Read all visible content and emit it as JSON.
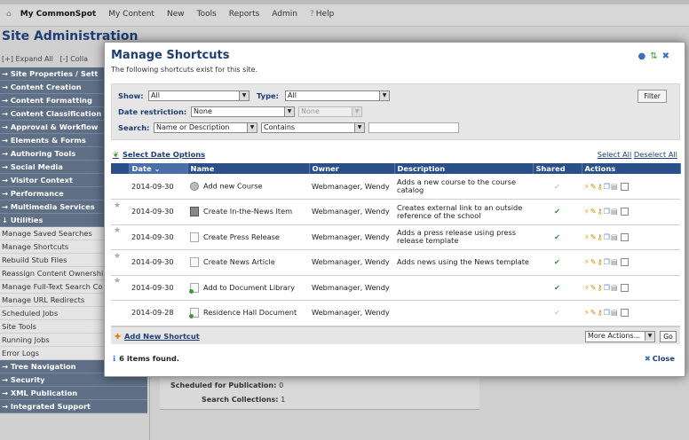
{
  "topbar": {
    "brand": "My CommonSpot",
    "menu": [
      "My Content",
      "New",
      "Tools",
      "Reports",
      "Admin"
    ],
    "help": "Help"
  },
  "background": {
    "title": "Site Administration",
    "expand_all": "[+] Expand All",
    "collapse_all": "[-] Colla",
    "sidebar": [
      {
        "label": "→ Site Properties / Sett",
        "style": "dark"
      },
      {
        "label": "→ Content Creation",
        "style": "dark"
      },
      {
        "label": "→ Content Formatting",
        "style": "dark"
      },
      {
        "label": "→ Content Classification",
        "style": "dark"
      },
      {
        "label": "→ Approval & Workflow",
        "style": "dark"
      },
      {
        "label": "→ Elements & Forms",
        "style": "dark"
      },
      {
        "label": "→ Authoring Tools",
        "style": "dark"
      },
      {
        "label": "→ Social Media",
        "style": "dark"
      },
      {
        "label": "→ Visitor Context",
        "style": "dark"
      },
      {
        "label": "→ Performance",
        "style": "dark"
      },
      {
        "label": "→ Multimedia Services",
        "style": "dark"
      },
      {
        "label": "↓ Utilities",
        "style": "dark"
      },
      {
        "label": "Manage Saved Searches",
        "style": "light"
      },
      {
        "label": "Manage Shortcuts",
        "style": "light"
      },
      {
        "label": "Rebuild Stub Files",
        "style": "light"
      },
      {
        "label": "Reassign Content Ownership",
        "style": "light"
      },
      {
        "label": "Manage Full-Text Search Co",
        "style": "light"
      },
      {
        "label": "Manage URL Redirects",
        "style": "light"
      },
      {
        "label": "Scheduled Jobs",
        "style": "light"
      },
      {
        "label": "Site Tools",
        "style": "light"
      },
      {
        "label": "Running Jobs",
        "style": "light"
      },
      {
        "label": "Error Logs",
        "style": "light"
      },
      {
        "label": "→ Tree Navigation",
        "style": "dark"
      },
      {
        "label": "→ Security",
        "style": "dark"
      },
      {
        "label": "→ XML Publication",
        "style": "dark"
      },
      {
        "label": "→ Integrated Support",
        "style": "dark"
      }
    ],
    "scheduled_label": "Scheduled for Publication:",
    "scheduled_value": "0",
    "search_label": "Search Collections:",
    "search_value": "1"
  },
  "modal": {
    "title": "Manage Shortcuts",
    "subtitle": "The following shortcuts exist for this site.",
    "filters": {
      "show_label": "Show:",
      "show_value": "All",
      "type_label": "Type:",
      "type_value": "All",
      "date_label": "Date restriction:",
      "date_value": "None",
      "date_value2": "None",
      "search_label": "Search:",
      "search_field": "Name or Description",
      "search_op": "Contains",
      "search_text": "",
      "filter_button": "Filter"
    },
    "select_dates": "Select Date Options",
    "select_all": "Select All",
    "deselect_all": "Deselect All",
    "columns": {
      "date": "Date",
      "name": "Name",
      "owner": "Owner",
      "description": "Description",
      "shared": "Shared",
      "actions": "Actions"
    },
    "rows": [
      {
        "date": "2014-09-30",
        "name": "Add new Course",
        "owner": "Webmanager, Wendy",
        "description": "Adds a new course to the course catalog",
        "shared": false,
        "starred": false,
        "icon": "gear-icon"
      },
      {
        "date": "2014-09-30",
        "name": "Create In-the-News Item",
        "owner": "Webmanager, Wendy",
        "description": "Creates external link to an outside reference of the school",
        "shared": true,
        "starred": true,
        "icon": "news-icon"
      },
      {
        "date": "2014-09-30",
        "name": "Create Press Release",
        "owner": "Webmanager, Wendy",
        "description": "Adds a press release using press release template",
        "shared": true,
        "starred": true,
        "icon": "page-icon"
      },
      {
        "date": "2014-09-30",
        "name": "Create News Article",
        "owner": "Webmanager, Wendy",
        "description": "Adds news using the News template",
        "shared": true,
        "starred": true,
        "icon": "page-icon"
      },
      {
        "date": "2014-09-30",
        "name": "Add to Document Library",
        "owner": "Webmanager, Wendy",
        "description": "",
        "shared": true,
        "starred": true,
        "icon": "document-icon"
      },
      {
        "date": "2014-09-28",
        "name": "Residence Hall Document",
        "owner": "Webmanager, Wendy",
        "description": "",
        "shared": false,
        "starred": false,
        "icon": "document-icon"
      }
    ],
    "add_new": "Add New Shortcut",
    "more_actions": "More Actions...",
    "go": "Go",
    "status": "6 items found.",
    "close": "Close"
  }
}
